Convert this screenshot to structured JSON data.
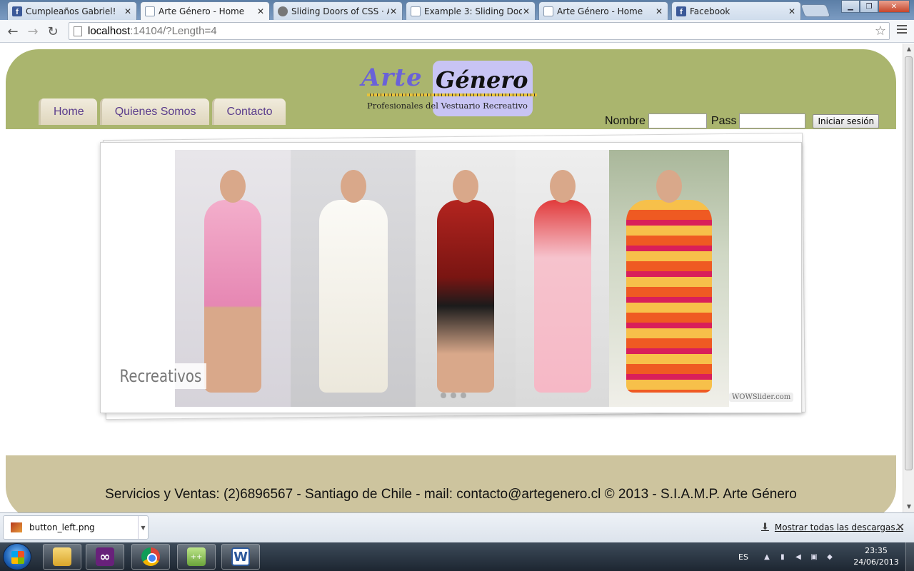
{
  "browser": {
    "tabs": [
      {
        "title": "Cumpleaños Gabriel!",
        "icon": "facebook-icon"
      },
      {
        "title": "Arte Género - Home",
        "icon": "page-icon",
        "active": true
      },
      {
        "title": "Sliding Doors of CSS · An",
        "icon": "site-icon"
      },
      {
        "title": "Example 3: Sliding Doors",
        "icon": "page-icon"
      },
      {
        "title": "Arte Género - Home",
        "icon": "page-icon"
      },
      {
        "title": "Facebook",
        "icon": "facebook-icon"
      }
    ],
    "tab_close": "✕",
    "url_host": "localhost",
    "url_path": ":14104/?Length=4"
  },
  "page": {
    "logo_arte": "Arte",
    "logo_genero": "Género",
    "logo_subtitle": "Profesionales del Vestuario Recreativo",
    "nav": [
      "Home",
      "Quienes Somos",
      "Contacto"
    ],
    "login": {
      "name_label": "Nombre",
      "pass_label": "Pass",
      "button": "Iniciar sesión"
    },
    "slider": {
      "caption": "Recreativos",
      "credit": "WOWSlider.com",
      "dots": 3
    },
    "footer_text": "Servicios y Ventas: (2)6896567 - Santiago de Chile - mail: contacto@artegenero.cl © 2013 - S.I.A.M.P. Arte Género"
  },
  "download_bar": {
    "file": "button_left.png",
    "show_all": "Mostrar todas las descargas..."
  },
  "taskbar": {
    "apps": [
      "explorer-icon",
      "visual-studio-icon",
      "chrome-icon",
      "notepad-plus-plus-icon",
      "word-icon"
    ],
    "lang": "ES",
    "time": "23:35",
    "date": "24/06/2013"
  },
  "colors": {
    "header": "#aab56e",
    "footer": "#cdc49e",
    "nav_text": "#5a3c8c",
    "logo_accent": "#c8c4f4"
  }
}
